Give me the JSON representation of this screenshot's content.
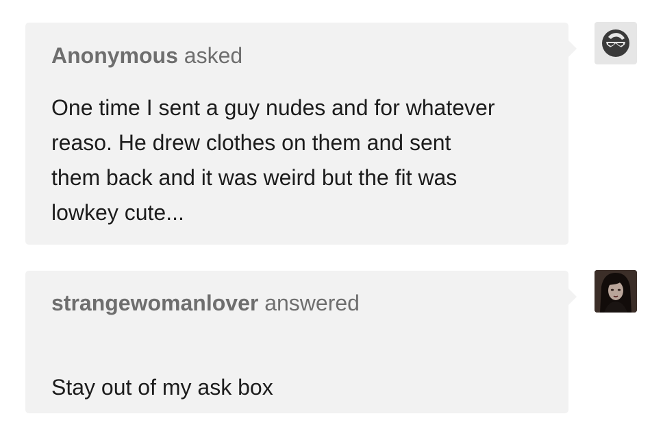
{
  "ask": {
    "author": "Anonymous",
    "verb": "asked",
    "lines": [
      "One time I sent a guy nudes and for whatever",
      "reaso. He drew clothes on them and sent",
      "them back and it was weird but the fit was",
      "lowkey cute..."
    ],
    "avatar_icon": "anonymous-sunglasses-face-icon"
  },
  "answer": {
    "author": "strangewomanlover",
    "verb": "answered",
    "lines": [
      "Stay out of my ask box"
    ],
    "avatar_icon": "user-portrait-photo"
  },
  "colors": {
    "bubble_bg": "#f2f2f2",
    "header_text": "#6e6e6e",
    "body_text": "#1c1c1c",
    "page_bg": "#ffffff"
  }
}
